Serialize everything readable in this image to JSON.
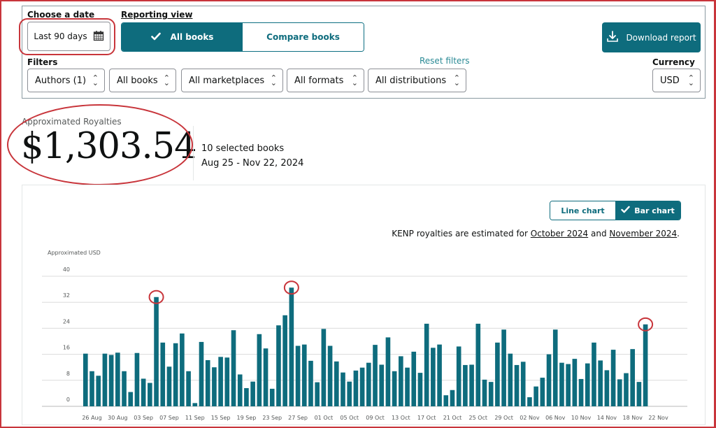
{
  "controls": {
    "date_label": "Choose a date",
    "date_value": "Last 90 days",
    "date_icon": "calendar-icon",
    "reporting_label": "Reporting view",
    "reporting_options": [
      {
        "label": "All books",
        "active": true
      },
      {
        "label": "Compare books",
        "active": false
      }
    ],
    "download_label": "Download report",
    "download_icon": "download-icon",
    "filters_label": "Filters",
    "reset_label": "Reset filters",
    "filters": [
      {
        "name": "authors",
        "value": "Authors (1)"
      },
      {
        "name": "books",
        "value": "All books"
      },
      {
        "name": "marketplaces",
        "value": "All marketplaces"
      },
      {
        "name": "formats",
        "value": "All formats"
      },
      {
        "name": "distributions",
        "value": "All distributions"
      }
    ],
    "currency_label": "Currency",
    "currency_value": "USD"
  },
  "summary": {
    "label": "Approximated Royalties",
    "amount": "$1,303.54",
    "books": "10 selected books",
    "range": "Aug 25 - Nov 22, 2024"
  },
  "chart_controls": {
    "line_label": "Line chart",
    "bar_label": "Bar chart",
    "selected": "Bar chart",
    "note_prefix": "KENP royalties are estimated for ",
    "note_link1": "October 2024",
    "note_mid": " and ",
    "note_link2": "November 2024",
    "note_suffix": "."
  },
  "colors": {
    "accent": "#0e6c7d",
    "bar": "#0e6c7d",
    "annotation": "#c8353b"
  },
  "chart_data": {
    "type": "bar",
    "title": "",
    "ylabel": "Approximated USD",
    "xlabel": "",
    "ylim": [
      0,
      40
    ],
    "yticks": [
      0,
      8,
      16,
      24,
      32,
      40
    ],
    "grid": true,
    "xtick_labels": [
      "26 Aug",
      "30 Aug",
      "03 Sep",
      "07 Sep",
      "11 Sep",
      "15 Sep",
      "19 Sep",
      "23 Sep",
      "27 Sep",
      "01 Oct",
      "05 Oct",
      "09 Oct",
      "13 Oct",
      "17 Oct",
      "21 Oct",
      "25 Oct",
      "29 Oct",
      "02 Nov",
      "06 Nov",
      "10 Nov",
      "14 Nov",
      "18 Nov",
      "22 Nov"
    ],
    "x_start": "2024-08-25",
    "x_end": "2024-11-22",
    "values": [
      16.2,
      10.8,
      9.4,
      16.2,
      15.8,
      16.5,
      10.8,
      4.4,
      16.4,
      8.5,
      7.2,
      33.6,
      19.6,
      12.2,
      19.4,
      22.4,
      10.8,
      1.0,
      19.8,
      14.2,
      12.0,
      15.2,
      15.0,
      23.4,
      9.8,
      5.6,
      7.6,
      22.2,
      17.8,
      5.4,
      24.9,
      28.0,
      36.5,
      18.6,
      19.0,
      14.0,
      7.4,
      23.8,
      18.6,
      13.8,
      10.4,
      7.6,
      11.0,
      11.9,
      13.4,
      18.9,
      12.8,
      21.2,
      10.8,
      15.4,
      11.9,
      16.8,
      10.3,
      25.4,
      18.0,
      19.0,
      3.4,
      5.0,
      18.4,
      12.7,
      12.8,
      25.4,
      8.2,
      7.5,
      19.6,
      23.6,
      16.2,
      12.7,
      13.7,
      2.8,
      6.1,
      8.8,
      16.0,
      23.6,
      13.4,
      13.0,
      14.6,
      8.4,
      13.2,
      19.6,
      14.1,
      11.1,
      17.4,
      8.3,
      10.2,
      17.6,
      7.5,
      25.2
    ],
    "highlighted_indices": [
      11,
      32,
      87
    ]
  }
}
